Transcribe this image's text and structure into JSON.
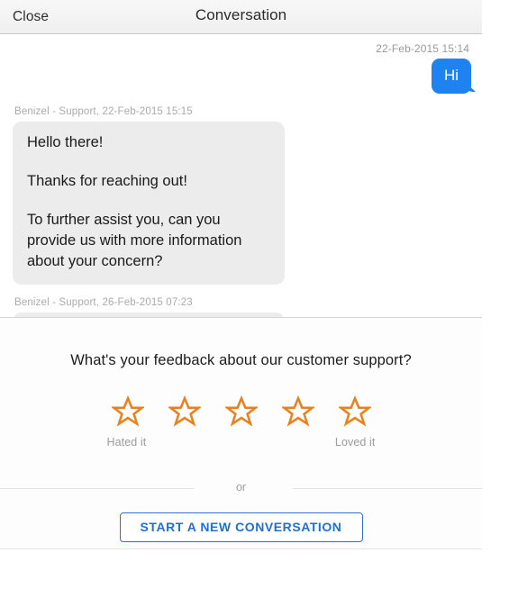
{
  "header": {
    "close_label": "Close",
    "title": "Conversation"
  },
  "conversation": {
    "messages": [
      {
        "direction": "outgoing",
        "timestamp": "22-Feb-2015 15:14",
        "text": "Hi"
      },
      {
        "direction": "incoming",
        "meta": "Benizel - Support, 22-Feb-2015 15:15",
        "paragraphs": [
          "Hello there!",
          "Thanks for reaching out!",
          "To further assist you, can you provide us with more information about your concern?"
        ]
      },
      {
        "direction": "incoming",
        "meta": "Benizel - Support, 26-Feb-2015 07:23",
        "paragraphs": []
      }
    ]
  },
  "feedback": {
    "question": "What's your feedback about our customer support?",
    "stars": [
      {
        "value": 1,
        "name": "star-1"
      },
      {
        "value": 2,
        "name": "star-2"
      },
      {
        "value": 3,
        "name": "star-3"
      },
      {
        "value": 4,
        "name": "star-4"
      },
      {
        "value": 5,
        "name": "star-5"
      }
    ],
    "low_label": "Hated it",
    "high_label": "Loved it",
    "selected_rating": 0,
    "or_text": "or",
    "new_conversation_label": "START A NEW CONVERSATION",
    "colors": {
      "star_outline": "#e8821e",
      "button_border": "#2f6fd0",
      "button_text": "#1f6fd4",
      "outgoing_bubble": "#1e83f0",
      "incoming_bubble": "#ececec"
    }
  }
}
